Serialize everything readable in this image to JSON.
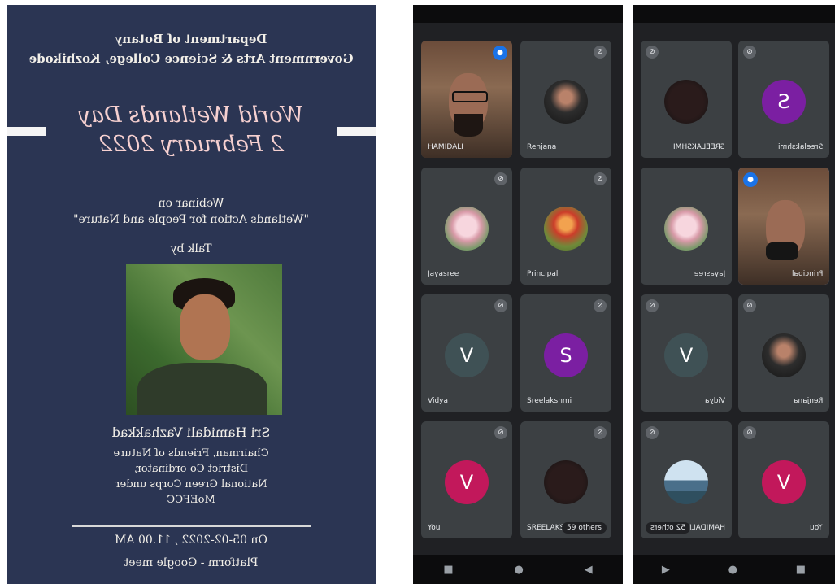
{
  "poster": {
    "dept_line1": "Department of Botany",
    "dept_line2": "Government Arts & Science College, Kozhikode",
    "event_line1": "World Wetlands Day",
    "event_line2": "2 February 2022",
    "webinar_label": "Webinar on",
    "webinar_title": "\"Wetlands Action for People and Nature\"",
    "talk_by": "Talk by",
    "speaker": "Sri Hamidali Vazhakkad",
    "role_line1": "Chairman, Friends of Nature",
    "role_line2": "District Co-ordinator,",
    "role_line3": "National Green Corps under",
    "role_line4": "MoEFCC",
    "date": "On 05-02-2022 , 11.00 AM",
    "platform": "Platform - Google meet"
  },
  "phone1": {
    "tiles": [
      {
        "name": "HAMIDALI"
      },
      {
        "name": "Renjana"
      },
      {
        "name": "Jayasree"
      },
      {
        "name": "Principal"
      },
      {
        "name": "Vidya",
        "initial": "V"
      },
      {
        "name": "Sreelakshmi",
        "initial": "S"
      },
      {
        "name": "You",
        "initial": "V"
      },
      {
        "name": "SREELAKS",
        "others": "59 others"
      }
    ]
  },
  "phone2": {
    "tiles": [
      {
        "name": "SREELAKSHMI"
      },
      {
        "name": "Sreelakshmi",
        "initial": "S"
      },
      {
        "name": "Jayasree"
      },
      {
        "name": "Principal"
      },
      {
        "name": "Vidya",
        "initial": "V"
      },
      {
        "name": "Renjana"
      },
      {
        "name": "HAMIDALI",
        "others": "52 others"
      },
      {
        "name": "You",
        "initial": "V"
      }
    ]
  },
  "icons": {
    "mic_off": "mic-off-icon",
    "speaking": "speaking-indicator-icon",
    "nav_back": "back-triangle-icon",
    "nav_home": "home-circle-icon",
    "nav_recents": "recents-square-icon"
  }
}
